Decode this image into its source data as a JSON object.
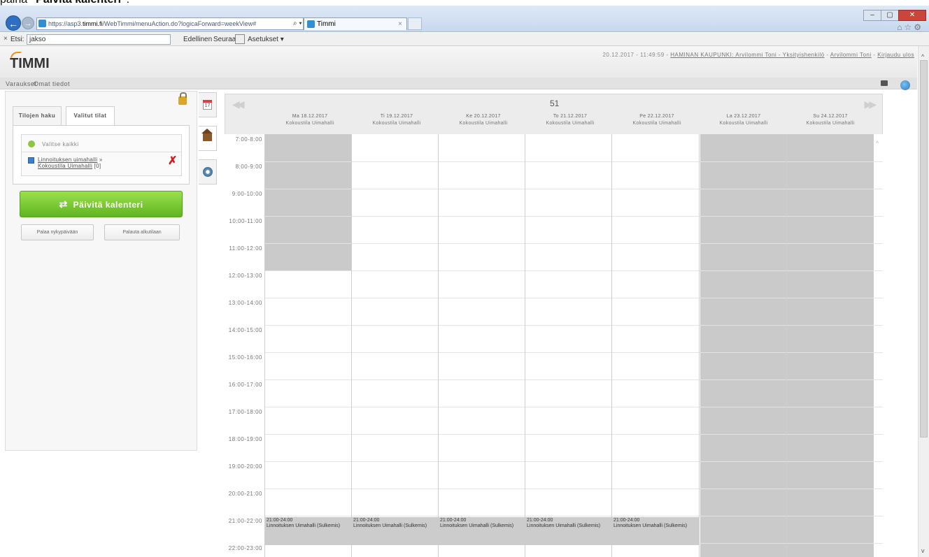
{
  "caption": {
    "prefix": "paina ",
    "bold": "\"Päivitä kalenteri\"",
    "suffix": "."
  },
  "browser": {
    "url_prefix": "https://asp3.",
    "url_domain": "timmi.fi",
    "url_rest": "/WebTimmi/menuAction.do?logicaForward=weekView#",
    "url_icons": "⌕ ▾ 🔒 ↻",
    "tab_title": "Timmi",
    "tab_close": "×"
  },
  "findbar": {
    "close": "×",
    "label": "Etsi:",
    "value": "jakso",
    "prev": "Edellinen",
    "next": "Seuraava",
    "options": "Asetukset ▾"
  },
  "app": {
    "logo": "TIMMI",
    "header_date": "20.12.2017 - 11:49:59 - ",
    "header_org": "HAMINAN KAUPUNKI: Arvilommi Toni - Yksityishenkilö",
    "header_sep": " - ",
    "header_user": "Arvilommi Toni",
    "header_logout": "Kirjaudu ulos",
    "nav_varaukset": "Varaukset",
    "nav_omat": "Omat tiedot"
  },
  "panel": {
    "tab_search": "Tilojen haku",
    "tab_selected": "Valitut tilat",
    "select_all": "Valitse kaikki",
    "item_line1": "Linnoituksen uimahalli",
    "item_sep": " »",
    "item_line2": "Kokoustila Uimahalli",
    "item_count": " [0]",
    "remove": "✗",
    "refresh_label": "Päivitä kalenteri",
    "refresh_icon": "⇄",
    "btn_today": "Palaa nykypäivään",
    "btn_reset": "Palauta alkutilaan"
  },
  "calendar": {
    "week": "51",
    "prev": "◀◀",
    "next": "▶▶",
    "days": [
      {
        "date": "Ma 18.12.2017",
        "room": "Kokoustila Uimahalli"
      },
      {
        "date": "Ti 19.12.2017",
        "room": "Kokoustila Uimahalli"
      },
      {
        "date": "Ke 20.12.2017",
        "room": "Kokoustila Uimahalli"
      },
      {
        "date": "To 21.12.2017",
        "room": "Kokoustila Uimahalli"
      },
      {
        "date": "Pe 22.12.2017",
        "room": "Kokoustila Uimahalli"
      },
      {
        "date": "La 23.12.2017",
        "room": "Kokoustila Uimahalli"
      },
      {
        "date": "Su 24.12.2017",
        "room": "Kokoustila Uimahalli"
      }
    ],
    "times": [
      "7:00-8:00",
      "8:00-9:00",
      "9:00-10:00",
      "10:00-11:00",
      "11:00-12:00",
      "12:00-13:00",
      "13:00-14:00",
      "14:00-15:00",
      "15:00-16:00",
      "16:00-17:00",
      "17:00-18:00",
      "18:00-19:00",
      "19:00-20:00",
      "20:00-21:00",
      "21:00-22:00",
      "22:00-23:00"
    ],
    "event_time": "21:00-24:00",
    "event_label": "Linnoituksen Uimahalli (Sulkemis)"
  }
}
